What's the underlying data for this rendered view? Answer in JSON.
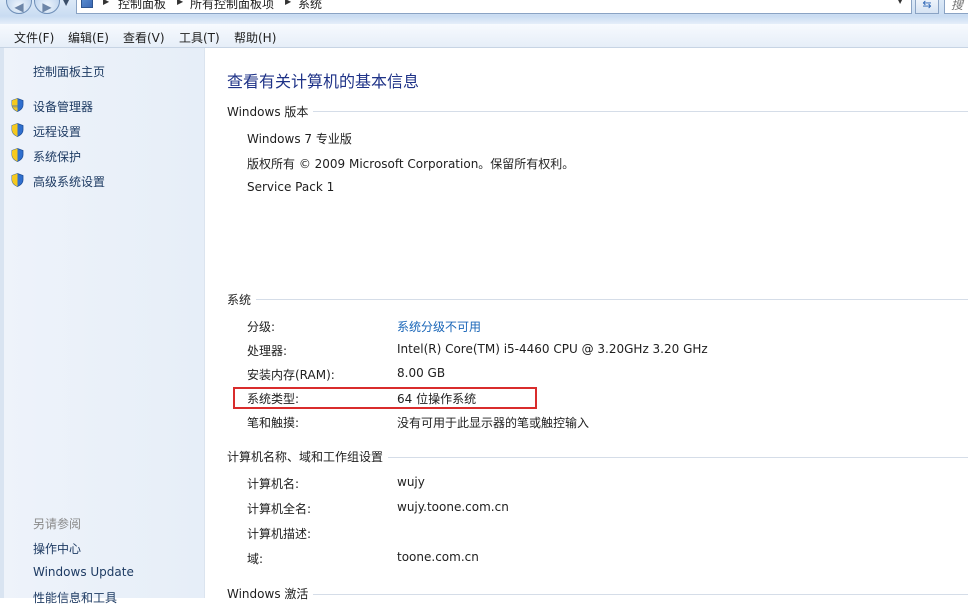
{
  "address_bar": {
    "crumbs": [
      "控制面板",
      "所有控制面板项",
      "系统"
    ],
    "search_placeholder": "搜"
  },
  "menu": {
    "file": "文件(F)",
    "edit": "编辑(E)",
    "view": "查看(V)",
    "tools": "工具(T)",
    "help": "帮助(H)"
  },
  "sidebar": {
    "home": "控制面板主页",
    "tasks": [
      "设备管理器",
      "远程设置",
      "系统保护",
      "高级系统设置"
    ],
    "see_also_heading": "另请参阅",
    "see_also": [
      "操作中心",
      "Windows Update",
      "性能信息和工具"
    ]
  },
  "main": {
    "title": "查看有关计算机的基本信息",
    "edition": {
      "heading": "Windows 版本",
      "name": "Windows 7 专业版",
      "copyright": "版权所有 © 2009 Microsoft Corporation。保留所有权利。",
      "service_pack": "Service Pack 1"
    },
    "system": {
      "heading": "系统",
      "rows": [
        {
          "label": "分级:",
          "value": "系统分级不可用",
          "is_link": true
        },
        {
          "label": "处理器:",
          "value": "Intel(R) Core(TM) i5-4460  CPU @ 3.20GHz   3.20 GHz",
          "is_link": false
        },
        {
          "label": "安装内存(RAM):",
          "value": "8.00 GB",
          "is_link": false
        },
        {
          "label": "系统类型:",
          "value": "64 位操作系统",
          "is_link": false
        },
        {
          "label": "笔和触摸:",
          "value": "没有可用于此显示器的笔或触控输入",
          "is_link": false
        }
      ]
    },
    "computer": {
      "heading": "计算机名称、域和工作组设置",
      "rows": [
        {
          "label": "计算机名:",
          "value": "wujy"
        },
        {
          "label": "计算机全名:",
          "value": "wujy.toone.com.cn"
        },
        {
          "label": "计算机描述:",
          "value": ""
        },
        {
          "label": "域:",
          "value": "toone.com.cn"
        }
      ]
    },
    "activation": {
      "heading": "Windows 激活"
    }
  },
  "colors": {
    "title": "#1e3287",
    "link": "#1a66b8",
    "highlight": "#d92c2c",
    "sidebar_bg": "#e9f0f9"
  }
}
